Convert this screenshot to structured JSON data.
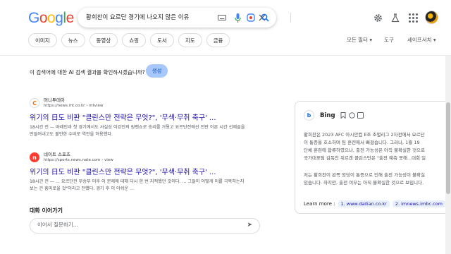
{
  "header": {
    "logo": "Google",
    "search_query": "황희찬이 요르단 경기에 나오지 않은 이유"
  },
  "tabs": [
    "이미지",
    "뉴스",
    "동영상",
    "쇼핑",
    "도서",
    "지도",
    "금융"
  ],
  "tools": {
    "filters": "모든 필터 ▾",
    "tools": "도구",
    "safesearch": "세이프서치 ▾"
  },
  "ai_prompt": {
    "question": "이 검색어에 대한 AI 검색 결과를 확인하시겠습니까?",
    "button": "생성"
  },
  "results": [
    {
      "source": "머니투데이",
      "url": "https://news.mt.co.kr › mtview",
      "favicon": "C",
      "title": "위기의 日도 비판 \"클린스만 전략은 무엇?\", '무색·무취 축구' ...",
      "snippet": "18시간 전 — 바레인과 첫 경기에서도 사실상 이강인의 원맨쇼로 승리를 거뒀고 요르단전에선 전반 이른 시간 선제골을 만들어내고도 불안한 수비로 역전을 허용했다."
    },
    {
      "source": "네이트 스포츠",
      "url": "https://sports.news.nate.com › view",
      "favicon": "n",
      "title": "위기의 日도 비판 \"클린스만 전략은 무엇?\", '무색·무취 축구' ...",
      "snippet": "18시간 전 — ... 요르단전 무승부 이후 이 문제에 대해 다시 한 번 지적했던 것이다. ... 그들이 어떻게 이를 극복하는지 보는 건 흥미로울 것\"이라고 전했다. 경기 후 이 아쉬운 ..."
    }
  ],
  "followup": {
    "label": "대화 이어가기",
    "placeholder": "이어서 질문하기..."
  },
  "bing": {
    "name": "Bing",
    "lines": [
      "황희찬은 2023 AFC 아시안컵 E조 조별리그 2차전에서 요르단",
      "이 통증을 호소하며 팀 훈련에서 빠졌습니다. 그러나, 1월 19",
      "단체 훈련에 합류하였으나, 출전 가능성은 아직 불확실한 것으로",
      "국가대표팀 감독인 위르겐 클린스만은 \"출전 예측 못해...대회 일",
      "저는 황희찬이 왼쪽 엉덩이 통증으로 인해 출전 가능성이 불확실",
      "있습니다. 하지만, 출전 여부는 아직 불확실한 것으로 보입니다."
    ],
    "learn_more": "Learn more :",
    "links": [
      "1. www.dailian.co.kr",
      "2. imnews.imbc.com"
    ]
  }
}
